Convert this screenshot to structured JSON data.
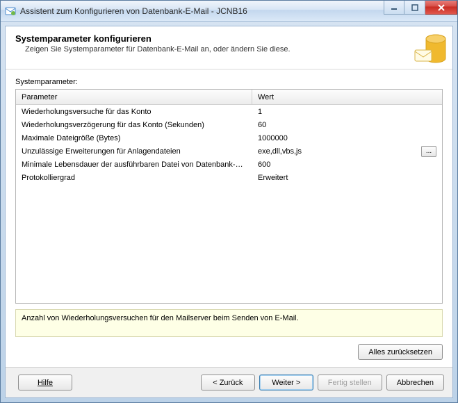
{
  "window": {
    "title": "Assistent zum Konfigurieren von Datenbank-E-Mail - JCNB16"
  },
  "header": {
    "title": "Systemparameter konfigurieren",
    "subtitle": "Zeigen Sie Systemparameter für Datenbank-E-Mail an, oder ändern Sie diese."
  },
  "section_label": "Systemparameter:",
  "columns": {
    "param": "Parameter",
    "value": "Wert"
  },
  "rows": [
    {
      "param": "Wiederholungsversuche für das Konto",
      "value": "1",
      "has_button": false
    },
    {
      "param": "Wiederholungsverzögerung für das Konto (Sekunden)",
      "value": "60",
      "has_button": false
    },
    {
      "param": "Maximale Dateigröße (Bytes)",
      "value": "1000000",
      "has_button": false
    },
    {
      "param": "Unzulässige Erweiterungen für Anlagendateien",
      "value": "exe,dll,vbs,js",
      "has_button": true
    },
    {
      "param": "Minimale Lebensdauer der ausführbaren Datei von Datenbank-E-M...",
      "value": "600",
      "has_button": false
    },
    {
      "param": "Protokolliergrad",
      "value": "Erweitert",
      "has_button": false
    }
  ],
  "hint": "Anzahl von Wiederholungsversuchen für den Mailserver beim Senden von E-Mail.",
  "buttons": {
    "reset_all": "Alles zurücksetzen",
    "help": "Hilfe",
    "back": "< Zurück",
    "next": "Weiter >",
    "finish": "Fertig stellen",
    "cancel": "Abbrechen",
    "ellipsis": "..."
  }
}
